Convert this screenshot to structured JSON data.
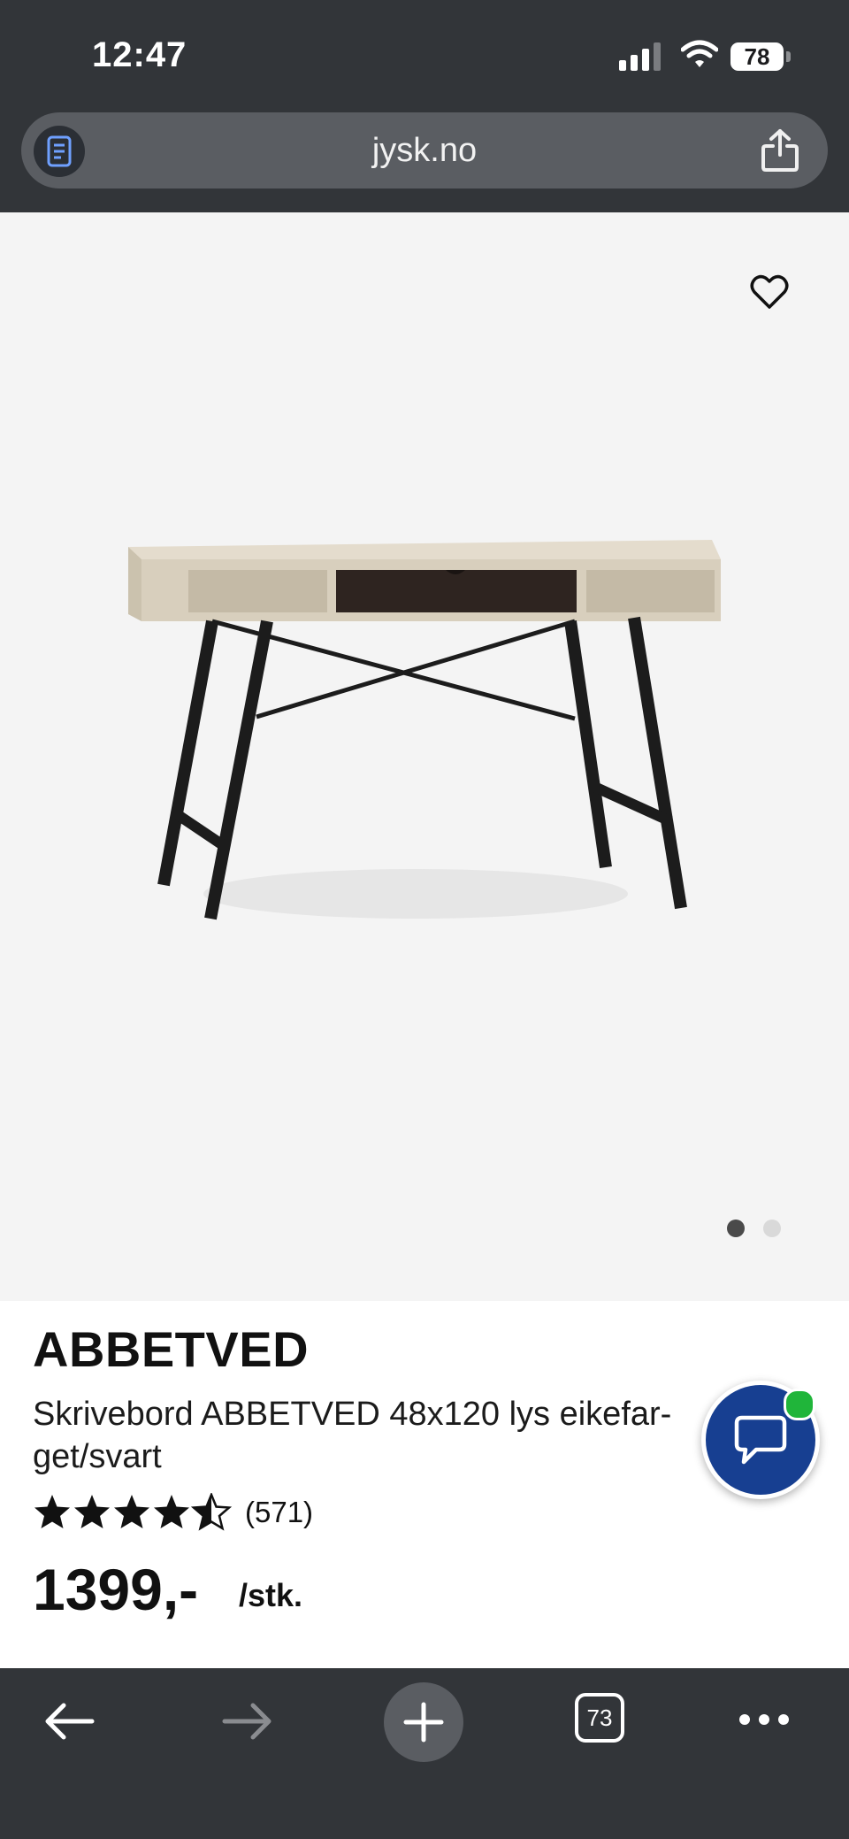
{
  "status_bar": {
    "time": "12:47",
    "battery": "78"
  },
  "browser": {
    "url": "jysk.no"
  },
  "product": {
    "name": "ABBETVED",
    "description": "Skrivebord ABBETVED 48x120 lys eikefar-get/svart",
    "rating": 4.5,
    "review_count": "(571)",
    "price": "1399,-",
    "unit": "/stk."
  },
  "gallery": {
    "image_count": 2,
    "active_index": 0
  },
  "toolbar": {
    "tab_count": "73"
  },
  "colors": {
    "chrome": "#323539",
    "chat_button": "#173f91",
    "online_dot": "#20b53a"
  }
}
